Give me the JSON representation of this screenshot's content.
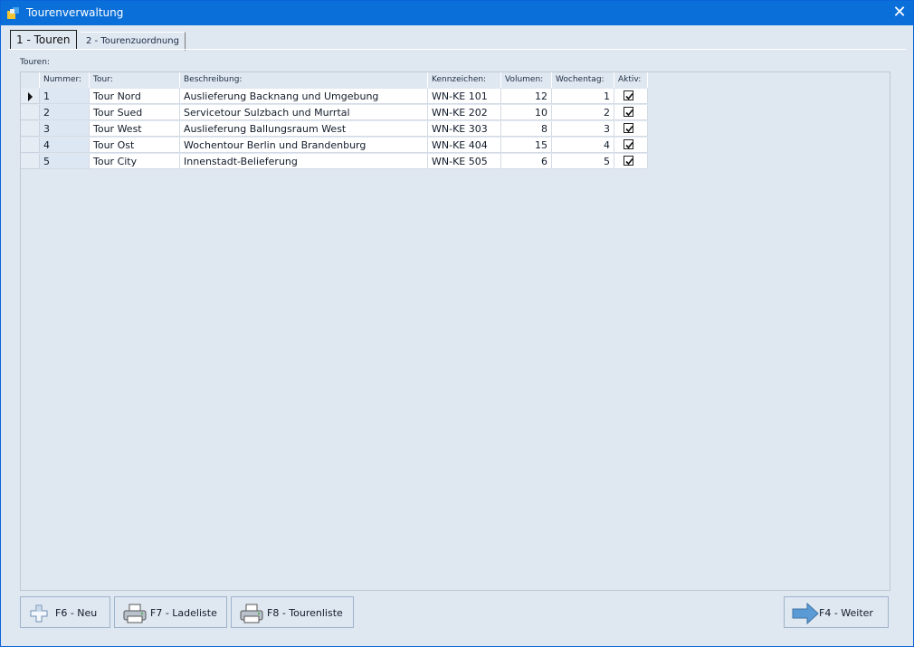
{
  "window": {
    "title": "Tourenverwaltung",
    "close_glyph": "✕"
  },
  "tabs": [
    {
      "label": "1 - Touren",
      "active": true
    },
    {
      "label": "2 - Tourenzuordnung",
      "active": false
    }
  ],
  "section_label": "Touren:",
  "columns": [
    "Nummer:",
    "Tour:",
    "Beschreibung:",
    "Kennzeichen:",
    "Volumen:",
    "Wochentag:",
    "Aktiv:"
  ],
  "rows": [
    {
      "nummer": "1",
      "tour": "Tour Nord",
      "beschreibung": "Auslieferung Backnang und Umgebung",
      "kennzeichen": "WN-KE 101",
      "volumen": "12",
      "wochentag": "1",
      "aktiv": true,
      "current": true
    },
    {
      "nummer": "2",
      "tour": "Tour Sued",
      "beschreibung": "Servicetour Sulzbach und Murrtal",
      "kennzeichen": "WN-KE 202",
      "volumen": "10",
      "wochentag": "2",
      "aktiv": true,
      "current": false
    },
    {
      "nummer": "3",
      "tour": "Tour West",
      "beschreibung": "Auslieferung Ballungsraum West",
      "kennzeichen": "WN-KE 303",
      "volumen": "8",
      "wochentag": "3",
      "aktiv": true,
      "current": false
    },
    {
      "nummer": "4",
      "tour": "Tour Ost",
      "beschreibung": "Wochentour Berlin und Brandenburg",
      "kennzeichen": "WN-KE 404",
      "volumen": "15",
      "wochentag": "4",
      "aktiv": true,
      "current": false
    },
    {
      "nummer": "5",
      "tour": "Tour City",
      "beschreibung": "Innenstadt-Belieferung",
      "kennzeichen": "WN-KE 505",
      "volumen": "6",
      "wochentag": "5",
      "aktiv": true,
      "current": false
    }
  ],
  "buttons": {
    "neu": {
      "label": "F6 - Neu",
      "icon": "add-plus-icon"
    },
    "ladeliste": {
      "label": "F7 - Ladeliste",
      "icon": "printer-icon"
    },
    "tourenliste": {
      "label": "F8 - Tourenliste",
      "icon": "printer-icon"
    },
    "weiter": {
      "label": "F4 - Weiter",
      "icon": "arrow-right-icon"
    }
  },
  "colors": {
    "titlebar": "#0a6fd8",
    "window_bg": "#dfe7f1",
    "accent_arrow": "#5b9bd5"
  }
}
